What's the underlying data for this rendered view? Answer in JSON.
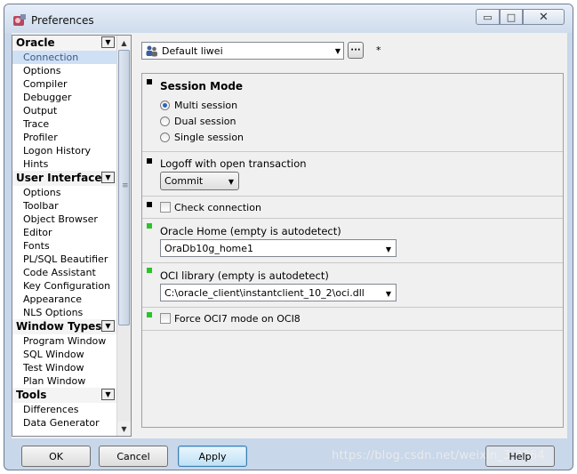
{
  "window": {
    "title": "Preferences",
    "min_glyph": "▭",
    "max_glyph": "□",
    "close_glyph": "✕"
  },
  "tree": {
    "categories": [
      {
        "label": "Oracle",
        "items": [
          "Connection",
          "Options",
          "Compiler",
          "Debugger",
          "Output",
          "Trace",
          "Profiler",
          "Logon History",
          "Hints"
        ],
        "selected": "Connection"
      },
      {
        "label": "User Interface",
        "items": [
          "Options",
          "Toolbar",
          "Object Browser",
          "Editor",
          "Fonts",
          "PL/SQL Beautifier",
          "Code Assistant",
          "Key Configuration",
          "Appearance",
          "NLS Options"
        ]
      },
      {
        "label": "Window Types",
        "items": [
          "Program Window",
          "SQL Window",
          "Test Window",
          "Plan Window"
        ]
      },
      {
        "label": "Tools",
        "items": [
          "Differences",
          "Data Generator"
        ]
      }
    ]
  },
  "profile": {
    "value": "Default liwei",
    "ellipsis": "···",
    "modified": "*"
  },
  "sections": {
    "session_mode": {
      "title": "Session Mode",
      "options": [
        "Multi session",
        "Dual session",
        "Single session"
      ],
      "selected_index": 0
    },
    "logoff": {
      "title": "Logoff with open transaction",
      "value": "Commit"
    },
    "check_connection": {
      "label": "Check connection",
      "checked": false
    },
    "oracle_home": {
      "title": "Oracle Home (empty is autodetect)",
      "value": "OraDb10g_home1"
    },
    "oci_library": {
      "title": "OCI library (empty is autodetect)",
      "value": "C:\\oracle_client\\instantclient_10_2\\oci.dll"
    },
    "force_oci7": {
      "label": "Force OCI7 mode on OCI8",
      "checked": false
    }
  },
  "buttons": {
    "ok": "OK",
    "cancel": "Cancel",
    "apply": "Apply",
    "help": "Help"
  },
  "watermark": "https://blog.csdn.net/weixin_3  3064",
  "colors": {
    "modified_marker": "#29c529",
    "default_marker": "#000000",
    "selection": "#cfe0f5"
  }
}
